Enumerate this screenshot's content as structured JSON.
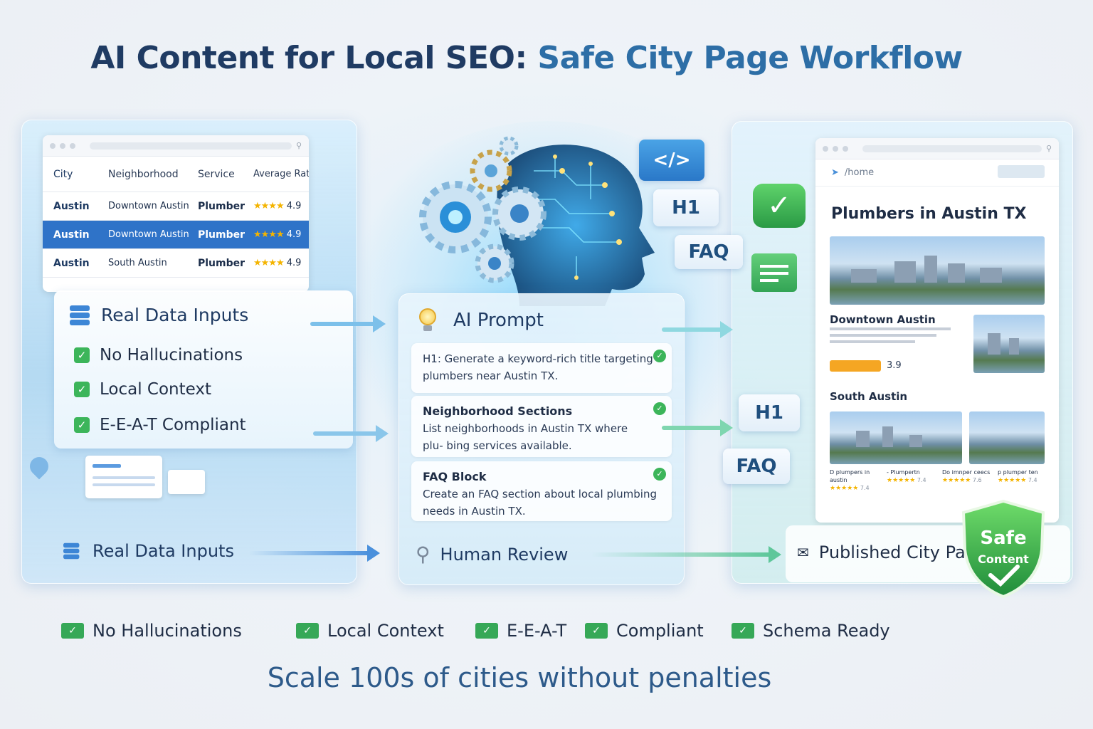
{
  "title": {
    "part1": "AI Content for Local SEO:",
    "part2": "Safe City Page Workflow"
  },
  "data_table": {
    "headers": [
      "City",
      "Neighborhood",
      "Service",
      "Average Rating"
    ],
    "rows": [
      {
        "city": "Austin",
        "neighborhood": "Downtown Austin",
        "service": "Plumber",
        "stars": "★★★★",
        "rating": "4.9"
      },
      {
        "city": "Austin",
        "neighborhood": "Downtown Austin",
        "service": "Plumber",
        "stars": "★★★★",
        "rating": "4.9"
      },
      {
        "city": "Austin",
        "neighborhood": "South Austin",
        "service": "Plumber",
        "stars": "★★★★",
        "rating": "4.9"
      }
    ]
  },
  "inputs_card": {
    "title": "Real Data Inputs",
    "checks": [
      "No Hallucinations",
      "Local Context",
      "E-E-A-T Compliant"
    ]
  },
  "prompt_panel": {
    "title": "AI Prompt",
    "items": [
      {
        "title": "",
        "text": "H1: Generate a keyword-rich title targeting plumbers near Austin TX."
      },
      {
        "title": "Neighborhood Sections",
        "text": "List neighborhoods in Austin TX where plu- bing services available."
      },
      {
        "title": "FAQ Block",
        "text": "Create an FAQ section about local plumbing needs in Austin TX."
      }
    ]
  },
  "tags": {
    "code": "</>",
    "h1_top": "H1",
    "faq_top": "FAQ",
    "h1_mid": "H1",
    "faq_mid": "FAQ"
  },
  "flow": {
    "step1": "Real Data Inputs",
    "step2": "Human Review",
    "step3": "Published City Page"
  },
  "city_page": {
    "breadcrumb": "/home",
    "heading": "Plumbers in Austin TX",
    "section1": "Downtown Austin",
    "section1_rating": "3.9",
    "section2": "South Austin",
    "listings": [
      {
        "name": "D plumpers in austin",
        "stars": "★★★★★",
        "rating": "7.4"
      },
      {
        "name": "- Plumpertn",
        "stars": "★★★★★",
        "rating": "7.4"
      },
      {
        "name": "Do imnper ceecs",
        "stars": "★★★★★",
        "rating": "7.6"
      },
      {
        "name": "p plumper ten",
        "stars": "★★★★★",
        "rating": "7.4"
      }
    ]
  },
  "shield": {
    "line1": "Safe",
    "line2": "Content"
  },
  "bottom_checks": [
    "No Hallucinations",
    "Local Context",
    "E-E-A-T",
    "Compliant",
    "Schema Ready"
  ],
  "tagline": "Scale 100s of cities without penalties",
  "colors": {
    "primary": "#1f3b63",
    "accent": "#2d6ea6",
    "selected_row": "#2f73c8",
    "check_green": "#3cb55a",
    "star": "#f4b400"
  }
}
